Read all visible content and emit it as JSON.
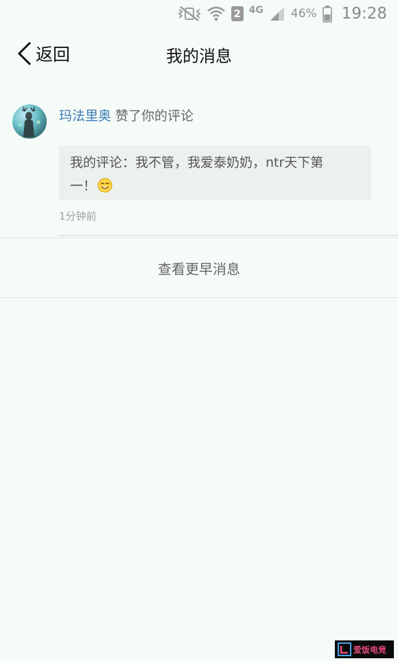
{
  "status_bar": {
    "battery_percent": "46%",
    "time": "19:28",
    "sim_slot": "2",
    "network": "4G"
  },
  "nav": {
    "back_label": "返回",
    "title": "我的消息"
  },
  "message": {
    "username": "玛法里奥",
    "action": "赞了你的评论",
    "comment_line1": "我的评论：我不管，我爱泰奶奶，ntr天下第",
    "comment_line2": "一！",
    "timestamp": "1分钟前"
  },
  "load_more_label": "查看更早消息",
  "watermark": {
    "text": "爱饭电竞"
  },
  "colors": {
    "background": "#f5fbf7",
    "username": "#3d7bb7",
    "comment_bg": "#edf1ee"
  }
}
